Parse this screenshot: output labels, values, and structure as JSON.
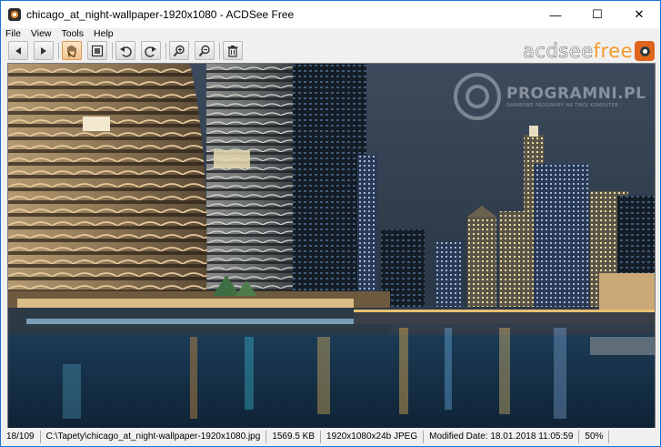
{
  "window": {
    "title": "chicago_at_night-wallpaper-1920x1080 - ACDSee Free",
    "minimize": "—",
    "maximize": "☐",
    "close": "✕"
  },
  "menu": [
    "File",
    "View",
    "Tools",
    "Help"
  ],
  "toolbar": {
    "buttons": [
      {
        "name": "previous",
        "icon": "arrow-left-icon"
      },
      {
        "name": "next",
        "icon": "arrow-right-icon"
      },
      {
        "name": "pan",
        "icon": "hand-icon",
        "active": true
      },
      {
        "name": "fit-to-window",
        "icon": "fit-icon"
      },
      {
        "name": "rotate-left",
        "icon": "rotate-left-icon"
      },
      {
        "name": "rotate-right",
        "icon": "rotate-right-icon"
      },
      {
        "name": "zoom-in",
        "icon": "zoom-in-icon"
      },
      {
        "name": "zoom-out",
        "icon": "zoom-out-icon"
      },
      {
        "name": "delete",
        "icon": "trash-icon"
      }
    ],
    "brand_text": "acdsee",
    "brand_free": "free",
    "brand_color": "#f39b2a"
  },
  "viewer": {
    "watermark_title": "PROGRAMNI.PL",
    "watermark_sub": "DARMOWE PROGRAMY NA TWÓJ KOMPUTER"
  },
  "status": {
    "position": "18/109",
    "path": "C:\\Tapety\\chicago_at_night-wallpaper-1920x1080.jpg",
    "size": "1569.5 KB",
    "format": "1920x1080x24b JPEG",
    "modified": "Modified Date: 18.01.2018 11:05:59",
    "zoom": "50%"
  },
  "colors": {
    "accent_border": "#1a75d2",
    "active_button": "#f2c48d"
  }
}
